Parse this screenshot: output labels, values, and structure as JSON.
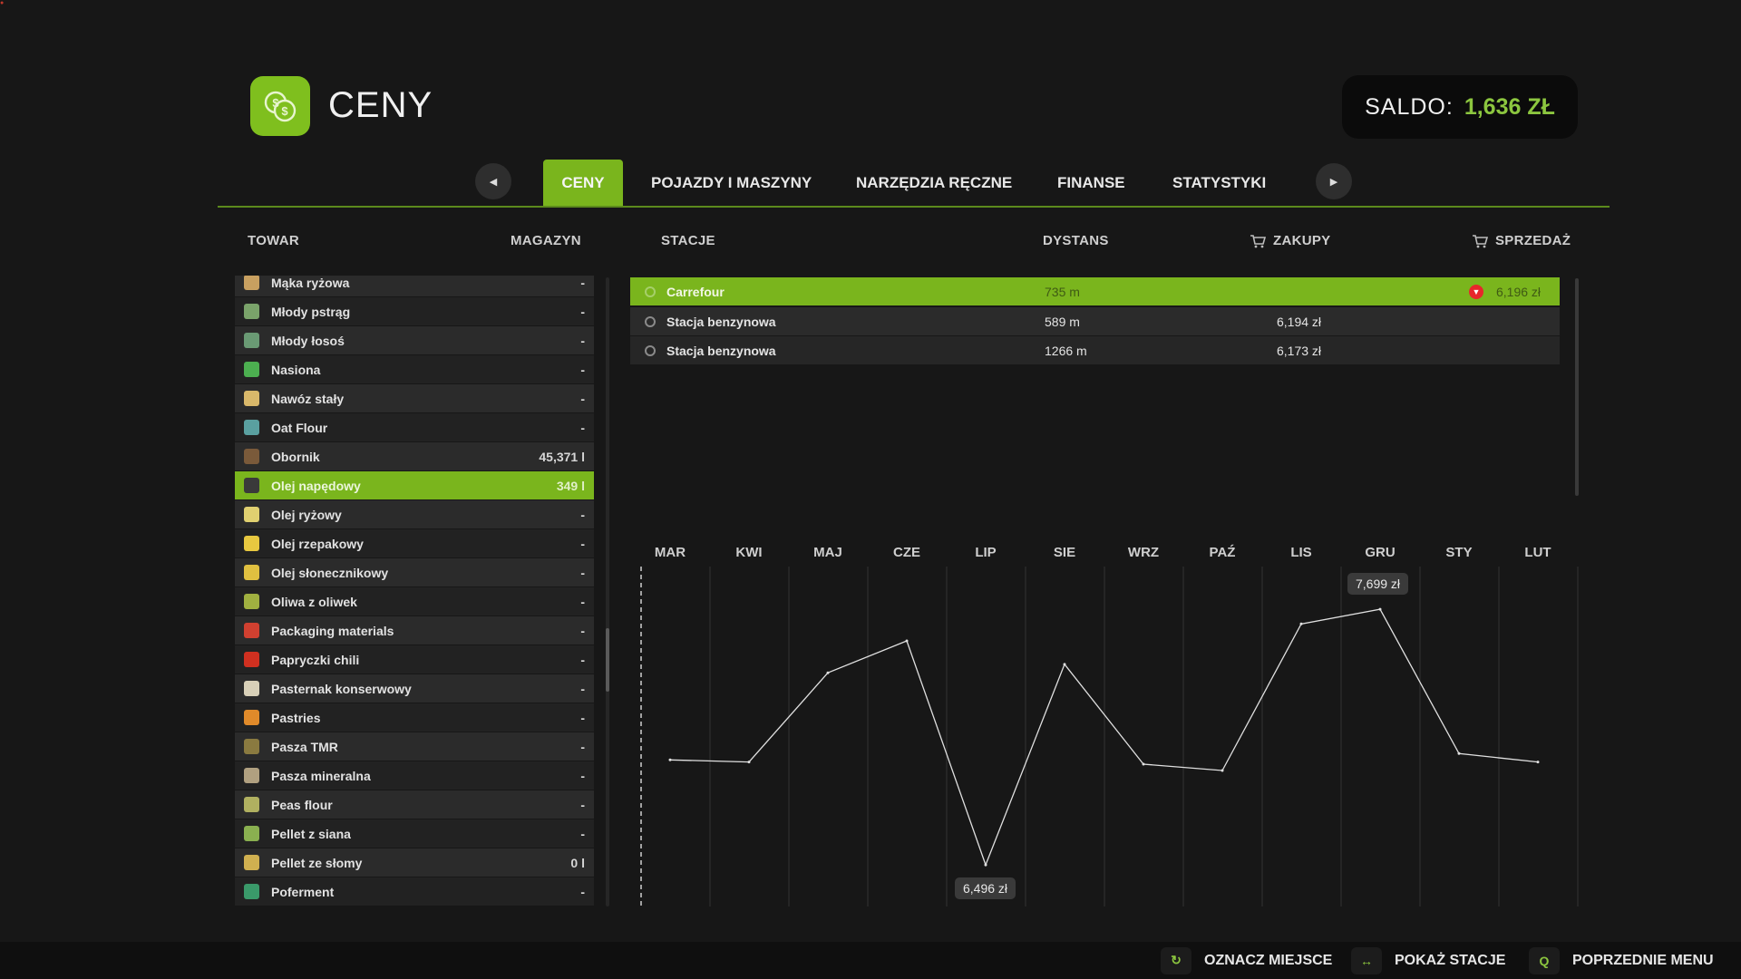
{
  "header": {
    "title": "CENY",
    "balance_label": "SALDO:",
    "balance_value": "1,636 ZŁ",
    "logo_icon": "coins-icon"
  },
  "tabs": [
    {
      "label": "CENY",
      "active": true
    },
    {
      "label": "POJAZDY I MASZYNY",
      "active": false
    },
    {
      "label": "NARZĘDZIA RĘCZNE",
      "active": false
    },
    {
      "label": "FINANSE",
      "active": false
    },
    {
      "label": "STATYSTYKI",
      "active": false
    }
  ],
  "columns": {
    "goods": "TOWAR",
    "storage": "MAGAZYN",
    "stations": "STACJE",
    "distance": "DYSTANS",
    "buy": "ZAKUPY",
    "sell": "SPRZEDAŻ"
  },
  "goods": [
    {
      "name": "Mąka ryżowa",
      "qty": "-",
      "icon_color": "#c8a060"
    },
    {
      "name": "Młody pstrąg",
      "qty": "-",
      "icon_color": "#7aa36a"
    },
    {
      "name": "Młody łosoś",
      "qty": "-",
      "icon_color": "#6a9a74"
    },
    {
      "name": "Nasiona",
      "qty": "-",
      "icon_color": "#4caf50"
    },
    {
      "name": "Nawóz stały",
      "qty": "-",
      "icon_color": "#d9b86a"
    },
    {
      "name": "Oat Flour",
      "qty": "-",
      "icon_color": "#5aa0a0"
    },
    {
      "name": "Obornik",
      "qty": "45,371 l",
      "icon_color": "#7a5a3a"
    },
    {
      "name": "Olej napędowy",
      "qty": "349 l",
      "icon_color": "#3a3a3a",
      "active": true
    },
    {
      "name": "Olej ryżowy",
      "qty": "-",
      "icon_color": "#e0d070"
    },
    {
      "name": "Olej rzepakowy",
      "qty": "-",
      "icon_color": "#e8c840"
    },
    {
      "name": "Olej słonecznikowy",
      "qty": "-",
      "icon_color": "#e0c040"
    },
    {
      "name": "Oliwa z oliwek",
      "qty": "-",
      "icon_color": "#a0b040"
    },
    {
      "name": "Packaging materials",
      "qty": "-",
      "icon_color": "#d04030"
    },
    {
      "name": "Papryczki chili",
      "qty": "-",
      "icon_color": "#d03020"
    },
    {
      "name": "Pasternak konserwowy",
      "qty": "-",
      "icon_color": "#d8d0b8"
    },
    {
      "name": "Pastries",
      "qty": "-",
      "icon_color": "#e08a2a"
    },
    {
      "name": "Pasza TMR",
      "qty": "-",
      "icon_color": "#8a7a40"
    },
    {
      "name": "Pasza mineralna",
      "qty": "-",
      "icon_color": "#b0a080"
    },
    {
      "name": "Peas flour",
      "qty": "-",
      "icon_color": "#b0b060"
    },
    {
      "name": "Pellet z siana",
      "qty": "-",
      "icon_color": "#8ab050"
    },
    {
      "name": "Pellet ze słomy",
      "qty": "0 l",
      "icon_color": "#d0b050"
    },
    {
      "name": "Poferment",
      "qty": "-",
      "icon_color": "#3a9a6a"
    }
  ],
  "stations": [
    {
      "name": "Carrefour",
      "distance": "735 m",
      "buy": "",
      "sell": "6,196 zł",
      "selected": true,
      "price_trend": "down"
    },
    {
      "name": "Stacja benzynowa",
      "distance": "589 m",
      "buy": "6,194 zł",
      "sell": ""
    },
    {
      "name": "Stacja benzynowa",
      "distance": "1266 m",
      "buy": "6,173 zł",
      "sell": ""
    }
  ],
  "chart_data": {
    "type": "line",
    "categories": [
      "MAR",
      "KWI",
      "MAJ",
      "CZE",
      "LIP",
      "SIE",
      "WRZ",
      "PAŹ",
      "LIS",
      "GRU",
      "STY",
      "LUT"
    ],
    "series": [
      {
        "values": [
          6.99,
          6.98,
          7.4,
          7.55,
          6.496,
          7.44,
          6.97,
          6.94,
          7.63,
          7.699,
          7.02,
          6.98
        ]
      }
    ],
    "tooltip_max": "7,699 zł",
    "tooltip_min": "6,496 zł",
    "ylim": [
      6.3,
      7.9
    ],
    "grid": true
  },
  "footer": {
    "hints": [
      {
        "key_icon": "refresh-icon",
        "label": "OZNACZ MIEJSCE"
      },
      {
        "key_icon": "arrows-icon",
        "label": "POKAŻ STACJE"
      },
      {
        "key": "Q",
        "label": "POPRZEDNIE MENU"
      }
    ]
  }
}
